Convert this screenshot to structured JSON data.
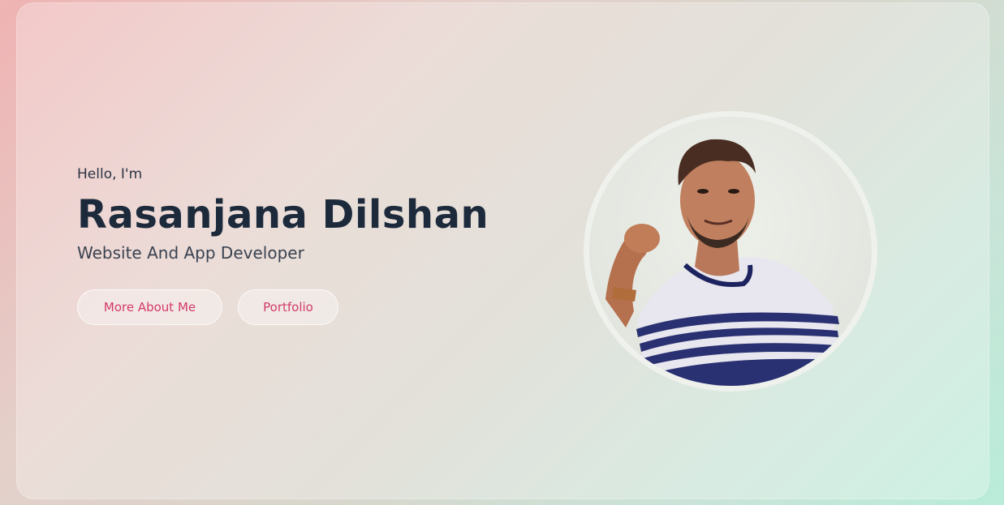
{
  "hero": {
    "greeting": "Hello, I'm",
    "name": "Rasanjana Dilshan",
    "role": "Website And App Developer"
  },
  "buttons": {
    "more_about_label": "More About Me",
    "portfolio_label": "Portfolio"
  },
  "colors": {
    "accent": "#d43a6a",
    "heading": "#1c2a3b"
  }
}
